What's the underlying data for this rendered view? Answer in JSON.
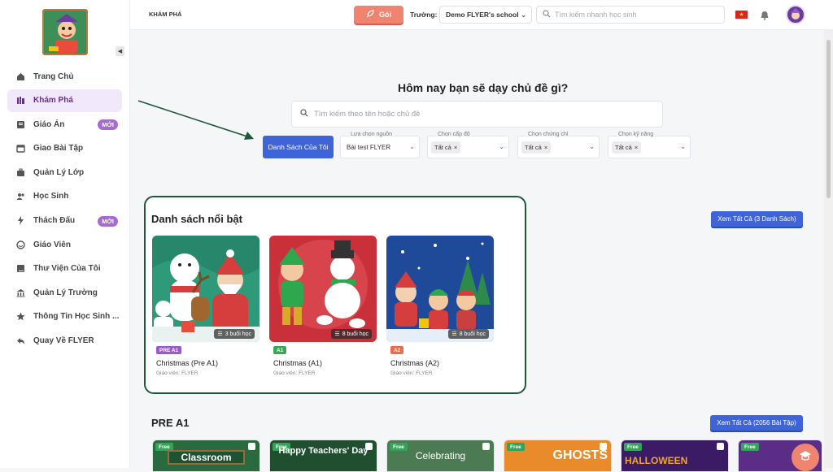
{
  "sidebar": {
    "items": [
      {
        "label": "Trang Chủ",
        "icon": "home-icon"
      },
      {
        "label": "Khám Phá",
        "icon": "explore-icon",
        "active": true
      },
      {
        "label": "Giáo Án",
        "icon": "lesson-plan-icon",
        "badge": "MỚI"
      },
      {
        "label": "Giao Bài Tập",
        "icon": "calendar-icon"
      },
      {
        "label": "Quản Lý Lớp",
        "icon": "briefcase-icon"
      },
      {
        "label": "Học Sinh",
        "icon": "students-icon"
      },
      {
        "label": "Thách Đấu",
        "icon": "lightning-icon",
        "badge": "MỚI"
      },
      {
        "label": "Giáo Viên",
        "icon": "teacher-icon"
      },
      {
        "label": "Thư Viện Của Tôi",
        "icon": "library-icon"
      },
      {
        "label": "Quản Lý Trường",
        "icon": "school-icon"
      },
      {
        "label": "Thông Tin Học Sinh ...",
        "icon": "star-icon"
      },
      {
        "label": "Quay Về FLYER",
        "icon": "back-icon"
      }
    ]
  },
  "topbar": {
    "breadcrumb": "KHÁM PHÁ",
    "goi_label": "Gói",
    "school_label": "Trường:",
    "school_value": "Demo FLYER's school",
    "search_placeholder": "Tìm kiếm nhanh học sinh",
    "accent": "#ef8470"
  },
  "hero": {
    "title": "Hôm nay bạn sẽ dạy chủ đề gì?",
    "search_placeholder": "Tìm kiếm theo tên hoặc chủ đề",
    "my_list_button": "Danh Sách Của Tôi",
    "filters": [
      {
        "label": "Lựa chọn nguồn",
        "value": "Bài test FLYER"
      },
      {
        "label": "Chọn cấp độ",
        "chip": "Tất cả"
      },
      {
        "label": "Chọn chứng chỉ",
        "chip": "Tất cả"
      },
      {
        "label": "Chọn kỹ năng",
        "chip": "Tất cả"
      }
    ]
  },
  "featured": {
    "title": "Danh sách nổi bật",
    "see_all": "Xem Tất Cả (3 Danh Sách)",
    "cards": [
      {
        "level": "PRE A1",
        "level_color": "#9b59d0",
        "title": "Christmas (Pre A1)",
        "teacher": "Giáo viên: FLYER",
        "sessions": "3 buổi học"
      },
      {
        "level": "A1",
        "level_color": "#3aa657",
        "title": "Christmas (A1)",
        "teacher": "Giáo viên: FLYER",
        "sessions": "8 buổi học"
      },
      {
        "level": "A2",
        "level_color": "#ef6a4a",
        "title": "Christmas (A2)",
        "teacher": "Giáo viên: FLYER",
        "sessions": "8 buổi học"
      }
    ]
  },
  "pre_a1": {
    "title": "PRE A1",
    "see_all": "Xem Tất Cả (2056 Bài Tập)",
    "free_label": "Free",
    "thumbs": [
      "Classroom",
      "Happy Teachers' Day",
      "Celebrating",
      "GHOSTS",
      "HALLOWEEN",
      ""
    ]
  }
}
